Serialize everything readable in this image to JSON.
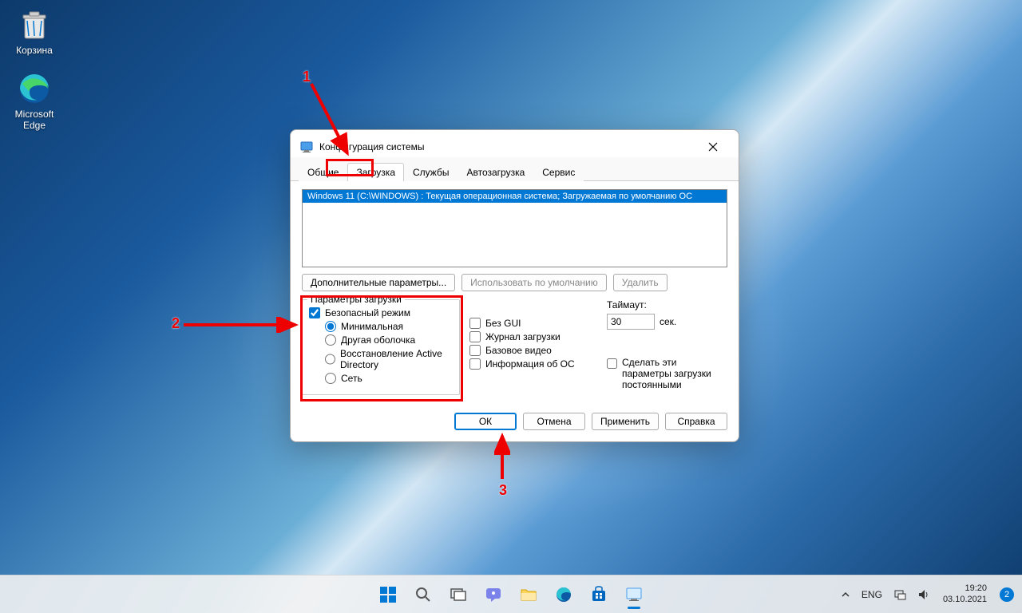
{
  "desktop": {
    "icons": [
      {
        "name": "recycle-bin",
        "label": "Корзина"
      },
      {
        "name": "edge",
        "label": "Microsoft Edge"
      }
    ]
  },
  "dialog": {
    "title": "Конфигурация системы",
    "tabs": [
      "Общие",
      "Загрузка",
      "Службы",
      "Автозагрузка",
      "Сервис"
    ],
    "activeTab": 1,
    "osList": "Windows 11 (C:\\WINDOWS) : Текущая операционная система; Загружаемая по умолчанию ОС",
    "advancedBtn": "Дополнительные параметры...",
    "defaultBtn": "Использовать по умолчанию",
    "deleteBtn": "Удалить",
    "bootOptionsTitle": "Параметры загрузки",
    "safeBoot": "Безопасный режим",
    "minimal": "Минимальная",
    "altShell": "Другая оболочка",
    "adRepair": "Восстановление Active Directory",
    "network": "Сеть",
    "noGui": "Без GUI",
    "bootLog": "Журнал загрузки",
    "baseVideo": "Базовое видео",
    "osInfo": "Информация  об ОС",
    "timeoutLabel": "Таймаут:",
    "timeoutValue": "30",
    "timeoutUnit": "сек.",
    "permanent": "Сделать эти параметры загрузки постоянными",
    "okBtn": "ОК",
    "cancelBtn": "Отмена",
    "applyBtn": "Применить",
    "helpBtn": "Справка"
  },
  "annotations": {
    "n1": "1",
    "n2": "2",
    "n3": "3"
  },
  "taskbar": {
    "lang": "ENG",
    "time": "19:20",
    "date": "03.10.2021",
    "notifications": "2"
  }
}
